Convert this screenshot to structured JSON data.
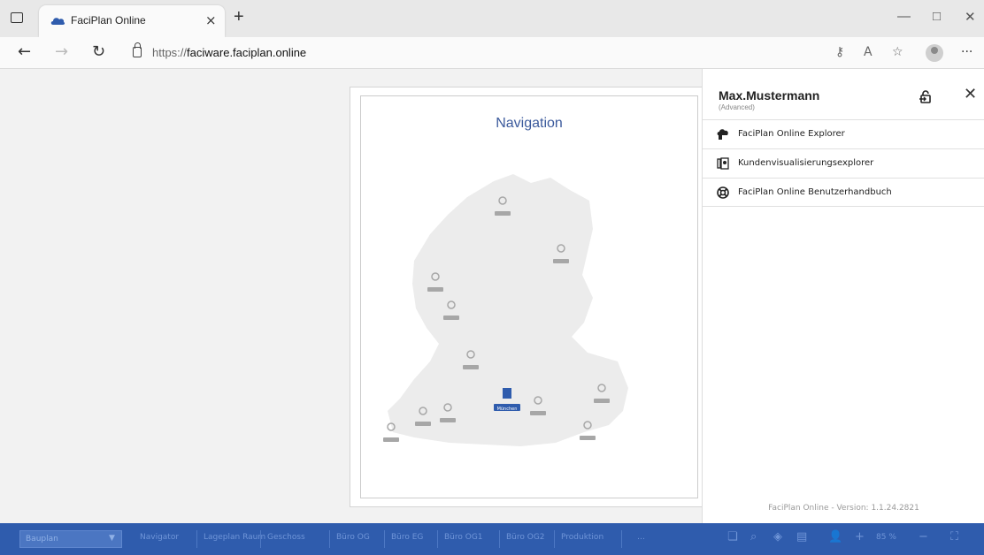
{
  "browser": {
    "tab_title": "FaciPlan Online",
    "url_prefix": "https://",
    "url_host": "faciware.faciplan.online",
    "new_tab": "+",
    "close_tab": "×",
    "minimize": "—",
    "maximize": "□",
    "close_window": "✕"
  },
  "document": {
    "title": "Navigation"
  },
  "map": {
    "fill_color": "#ececec",
    "pin_color": "#a7a7a7",
    "active_color": "#2f5cad",
    "active_city": "München"
  },
  "panel": {
    "user_name": "Max.Mustermann",
    "user_role": "(Advanced)",
    "close_label": "✕",
    "menu": [
      {
        "label": "FaciPlan Online Explorer",
        "icon": "explorer-icon"
      },
      {
        "label": "Kundenvisualisierungsexplorer",
        "icon": "visualization-icon"
      },
      {
        "label": "FaciPlan Online Benutzerhandbuch",
        "icon": "help-lifebuoy-icon"
      }
    ],
    "version": "FaciPlan Online - Version: 1.1.24.2821"
  },
  "bottombar": {
    "select_value": "Bauplan",
    "tabs": [
      "Navigator",
      "Lageplan Raum",
      "Geschoss",
      "Büro OG",
      "Büro EG",
      "Büro OG1",
      "Büro OG2",
      "Produktion",
      "…"
    ],
    "zoom": "85 %",
    "accent": "#2f5cad"
  }
}
